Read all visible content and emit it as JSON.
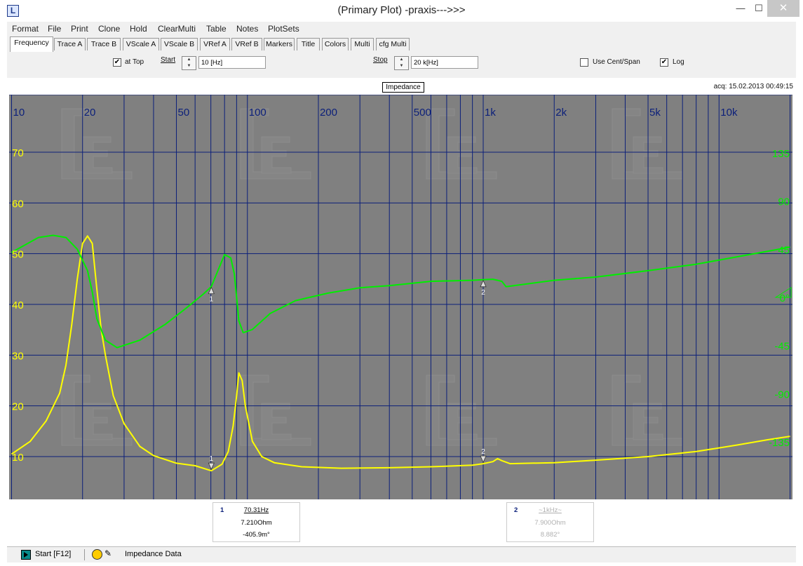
{
  "window": {
    "title": "(Primary Plot) -praxis--->>>",
    "app_icon": "L"
  },
  "menu": [
    "Format",
    "File",
    "Print",
    "Clone",
    "Hold",
    "ClearMulti",
    "Table",
    "Notes",
    "PlotSets"
  ],
  "tabs": [
    "Frequency",
    "Trace A",
    "Trace B",
    "VScale A",
    "VScale B",
    "VRef A",
    "VRef B",
    "Markers",
    "Title",
    "Colors",
    "Multi",
    "cfg Multi"
  ],
  "settings": {
    "at_top_label": "at Top",
    "at_top_checked": true,
    "start_label": "Start",
    "start_value": "10 [Hz]",
    "stop_label": "Stop",
    "stop_value": "20 k[Hz]",
    "centspan_label": "Use Cent/Span",
    "centspan_checked": false,
    "log_label": "Log",
    "log_checked": true
  },
  "plot": {
    "title": "Impedance",
    "acq": "acq: 15.02.2013 00:49:15",
    "colors": {
      "background": "#808080",
      "grid": "#0b1f7a",
      "trace_a": "#ffff00",
      "trace_b": "#00ee00",
      "freq_labels": "#0b1f7a"
    }
  },
  "chart_data": {
    "type": "line",
    "title": "Impedance",
    "x_scale": "log",
    "xlim": [
      10,
      20000
    ],
    "x_tick_labels": [
      {
        "value": 10,
        "label": "10"
      },
      {
        "value": 20,
        "label": "20"
      },
      {
        "value": 50,
        "label": "50"
      },
      {
        "value": 100,
        "label": "100"
      },
      {
        "value": 200,
        "label": "200"
      },
      {
        "value": 500,
        "label": "500"
      },
      {
        "value": 1000,
        "label": "1k"
      },
      {
        "value": 2000,
        "label": "2k"
      },
      {
        "value": 5000,
        "label": "5k"
      },
      {
        "value": 10000,
        "label": "10k"
      }
    ],
    "y_left": {
      "ticks": [
        70,
        60,
        50,
        40,
        30,
        20,
        10
      ],
      "ylim": [
        0,
        80
      ],
      "color": "#ffff00"
    },
    "y_right": {
      "ticks": [
        135,
        90,
        45,
        0,
        -45,
        -90,
        -135
      ],
      "ylim": [
        -180,
        180
      ],
      "color": "#00ee00"
    },
    "grid": true,
    "series": [
      {
        "axis": "left",
        "color": "#ffff00",
        "points": [
          [
            10,
            10.5
          ],
          [
            12,
            13
          ],
          [
            14,
            17
          ],
          [
            16,
            22.5
          ],
          [
            17,
            28
          ],
          [
            18,
            36
          ],
          [
            19,
            45
          ],
          [
            20,
            52
          ],
          [
            21,
            53.5
          ],
          [
            22,
            52
          ],
          [
            23,
            43
          ],
          [
            24,
            35
          ],
          [
            25,
            30
          ],
          [
            27,
            22
          ],
          [
            30,
            16.5
          ],
          [
            35,
            12
          ],
          [
            40,
            10.2
          ],
          [
            50,
            8.7
          ],
          [
            60,
            8.2
          ],
          [
            70.31,
            7.21
          ],
          [
            78,
            8.5
          ],
          [
            83,
            11
          ],
          [
            87,
            16
          ],
          [
            90,
            22
          ],
          [
            92,
            26.5
          ],
          [
            95,
            25
          ],
          [
            98,
            20
          ],
          [
            105,
            13
          ],
          [
            115,
            10
          ],
          [
            130,
            8.8
          ],
          [
            170,
            8
          ],
          [
            250,
            7.7
          ],
          [
            400,
            7.8
          ],
          [
            600,
            8
          ],
          [
            900,
            8.3
          ],
          [
            1000,
            8.6
          ],
          [
            1100,
            9
          ],
          [
            1150,
            9.6
          ],
          [
            1200,
            9.2
          ],
          [
            1300,
            8.6
          ],
          [
            2000,
            8.8
          ],
          [
            3000,
            9.3
          ],
          [
            5000,
            10
          ],
          [
            8000,
            11
          ],
          [
            12000,
            12.3
          ],
          [
            16000,
            13.3
          ],
          [
            20000,
            14
          ]
        ]
      },
      {
        "axis": "right",
        "color": "#00ee00",
        "points": [
          [
            10,
            42
          ],
          [
            13,
            56
          ],
          [
            15,
            58
          ],
          [
            17,
            56
          ],
          [
            19,
            45
          ],
          [
            21,
            25
          ],
          [
            22,
            5
          ],
          [
            23,
            -20
          ],
          [
            25,
            -40
          ],
          [
            28,
            -47
          ],
          [
            35,
            -40
          ],
          [
            45,
            -25
          ],
          [
            55,
            -10
          ],
          [
            65,
            3
          ],
          [
            70.31,
            10
          ],
          [
            75,
            25
          ],
          [
            80,
            40
          ],
          [
            85,
            37
          ],
          [
            88,
            22
          ],
          [
            90,
            0
          ],
          [
            92,
            -22
          ],
          [
            96,
            -33
          ],
          [
            105,
            -30
          ],
          [
            125,
            -15
          ],
          [
            160,
            -3
          ],
          [
            220,
            4
          ],
          [
            300,
            9
          ],
          [
            400,
            11
          ],
          [
            600,
            15
          ],
          [
            900,
            16
          ],
          [
            1000,
            16.5
          ],
          [
            1100,
            17
          ],
          [
            1200,
            15
          ],
          [
            1250,
            10
          ],
          [
            1350,
            11
          ],
          [
            2000,
            16
          ],
          [
            3000,
            19
          ],
          [
            5000,
            25
          ],
          [
            8000,
            31
          ],
          [
            12000,
            38
          ],
          [
            16000,
            43
          ],
          [
            20000,
            47
          ]
        ]
      }
    ],
    "markers": [
      {
        "id": "1",
        "x": 70.31
      },
      {
        "id": "2",
        "x": 1000
      }
    ]
  },
  "readouts": [
    {
      "num": "1",
      "freq": "70.31Hz",
      "z": "7.210Ohm",
      "phase": "-405.9m°",
      "dim": false
    },
    {
      "num": "2",
      "freq": "~1kHz~",
      "z": "7.900Ohm",
      "phase": "8.882°",
      "dim": true
    }
  ],
  "status": {
    "start_label": "Start [F12]",
    "text": "Impedance Data"
  },
  "icons": [
    "app-logo-icon",
    "minimize-icon",
    "maximize-icon",
    "close-icon",
    "play-icon",
    "gauge-icon",
    "wand-icon"
  ]
}
